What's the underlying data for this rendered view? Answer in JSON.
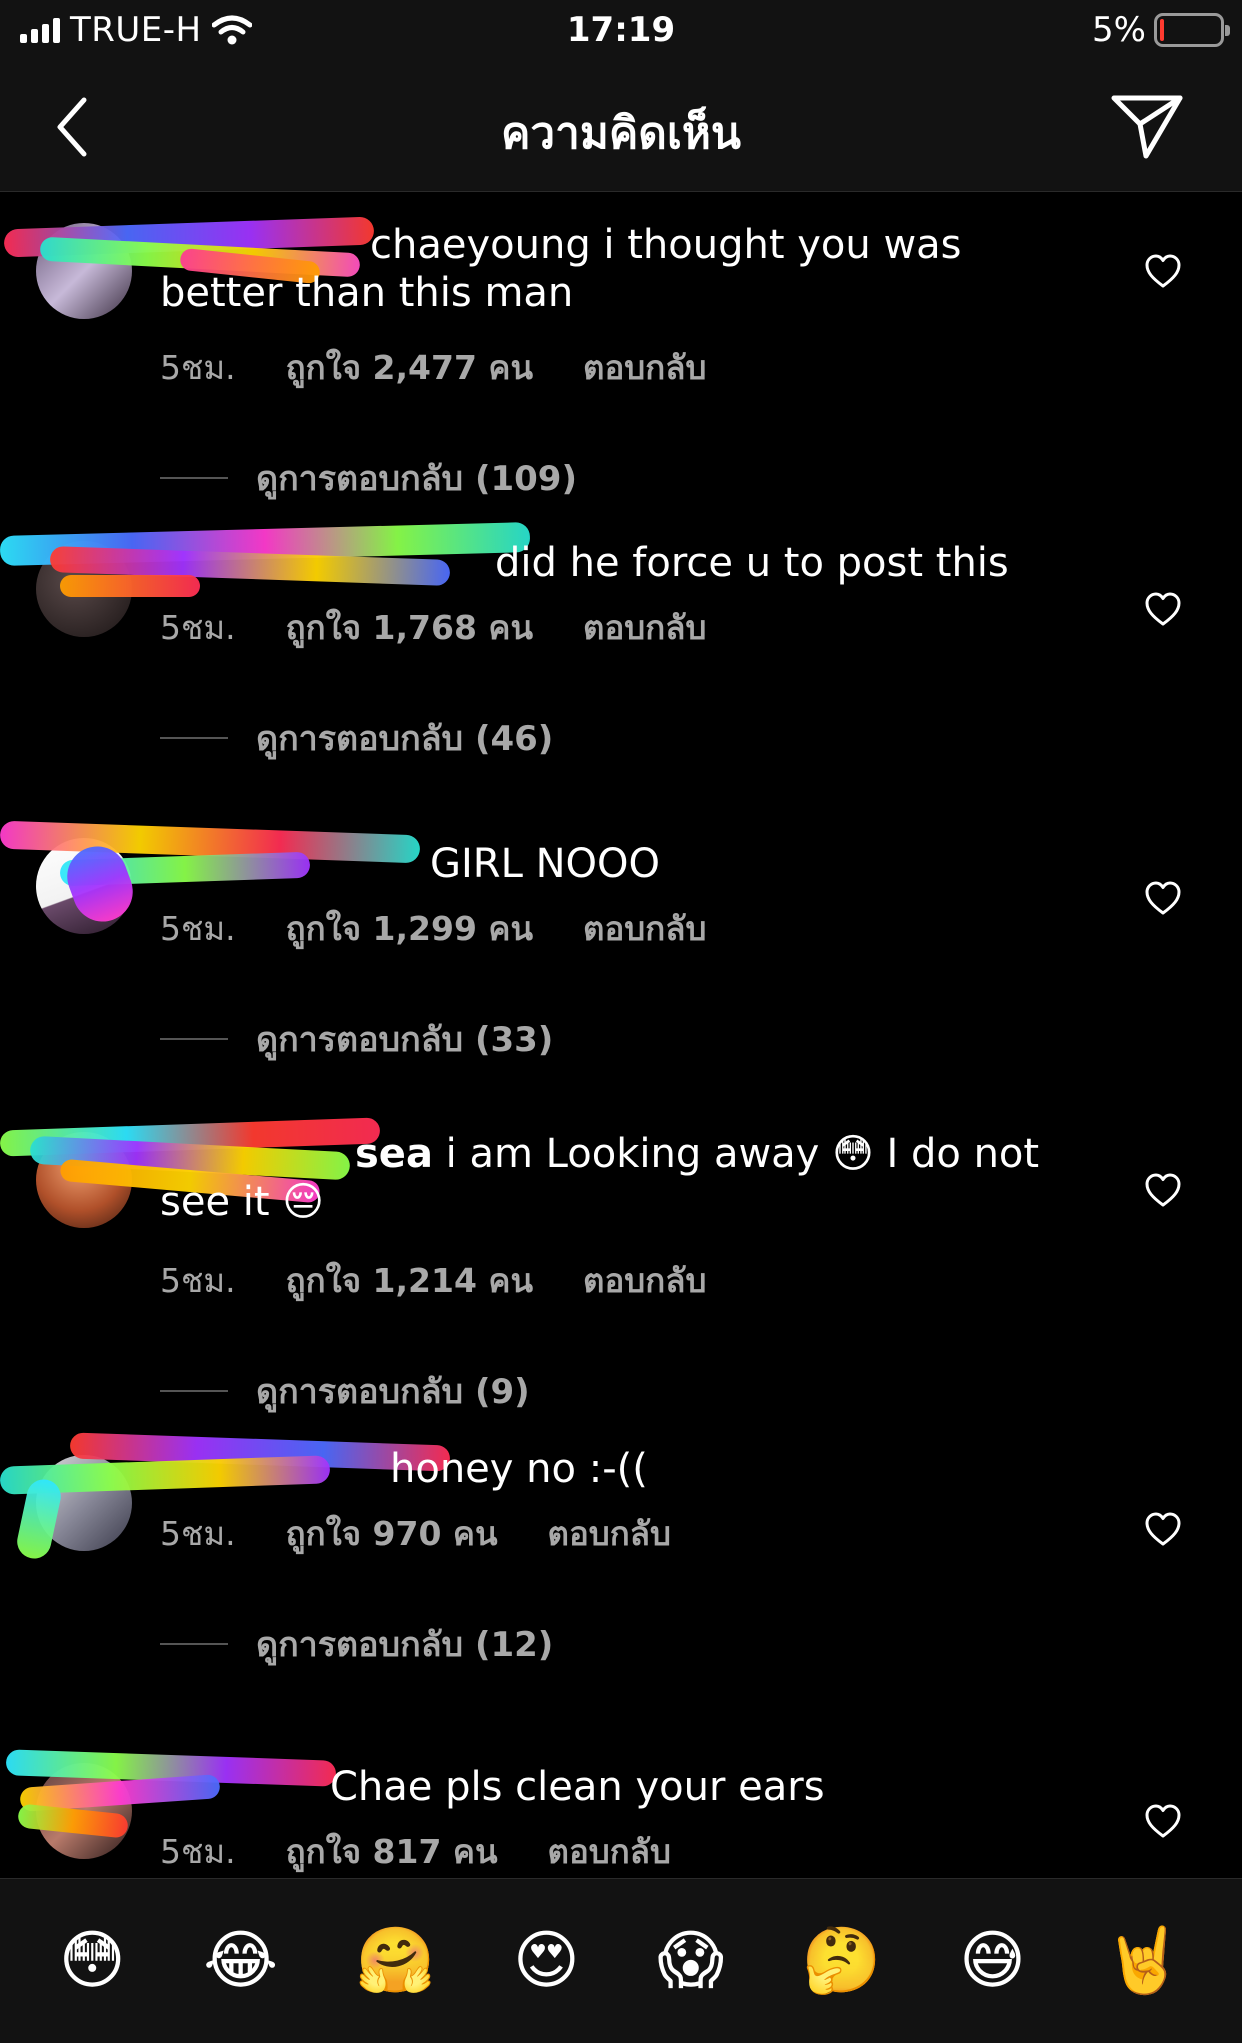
{
  "status_bar": {
    "carrier": "TRUE-H",
    "time": "17:19",
    "battery": "5%",
    "icons": [
      "signal-icon",
      "wifi-icon",
      "battery-icon"
    ],
    "battery_level": 0.05
  },
  "nav": {
    "title": "ความคิดเห็น",
    "icons": [
      "chevron-left-icon",
      "send-icon"
    ]
  },
  "comments": [
    {
      "username": "",
      "text": "chaeyoung i thought you was better than this man",
      "time": "5ชม.",
      "likes": "ถูกใจ 2,477 คน",
      "reply": "ตอบกลับ",
      "view_replies": "ดูการตอบกลับ (109)"
    },
    {
      "username": "",
      "text": "did he force u to post this",
      "time": "5ชม.",
      "likes": "ถูกใจ 1,768 คน",
      "reply": "ตอบกลับ",
      "view_replies": "ดูการตอบกลับ (46)"
    },
    {
      "username": "",
      "text": "GIRL NOOO",
      "time": "5ชม.",
      "likes": "ถูกใจ 1,299 คน",
      "reply": "ตอบกลับ",
      "view_replies": "ดูการตอบกลับ (33)"
    },
    {
      "username": "sea",
      "text": "i am Looking away 😳 I do not see it 😔",
      "time": "5ชม.",
      "likes": "ถูกใจ 1,214 คน",
      "reply": "ตอบกลับ",
      "view_replies": "ดูการตอบกลับ (9)"
    },
    {
      "username": "",
      "text": "honey no :-((",
      "time": "5ชม.",
      "likes": "ถูกใจ 970 คน",
      "reply": "ตอบกลับ",
      "view_replies": "ดูการตอบกลับ (12)"
    },
    {
      "username": "",
      "text": "Chae pls clean your ears",
      "time": "5ชม.",
      "likes": "ถูกใจ 817 คน",
      "reply": "ตอบกลับ",
      "view_replies": ""
    }
  ],
  "emoji_bar": [
    "😳",
    "😂",
    "🤗",
    "😍",
    "😱",
    "🤔",
    "😅",
    "🤘"
  ],
  "colors": {
    "background": "#000000",
    "header": "#121212",
    "secondary_text": "#a8a8a8",
    "battery_low": "#ff3b30"
  }
}
